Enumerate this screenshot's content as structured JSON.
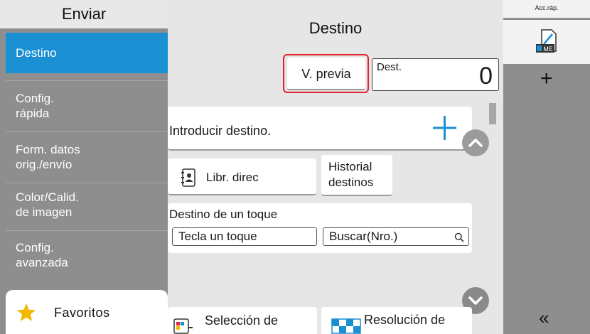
{
  "left": {
    "title": "Enviar",
    "items": [
      {
        "line1": "Destino",
        "line2": ""
      },
      {
        "line1": "Config.",
        "line2": "rápida"
      },
      {
        "line1": "Form. datos",
        "line2": "orig./envío"
      },
      {
        "line1": "Color/Calid.",
        "line2": "de imagen"
      },
      {
        "line1": "Config.",
        "line2": "avanzada"
      }
    ],
    "favorites": "Favoritos"
  },
  "main": {
    "title": "Destino",
    "preview": "V. previa",
    "dest_label": "Dest.",
    "dest_count": "0",
    "enter_destination": "Introducir destino.",
    "address_book": "Libr. direc",
    "history_line1": "Historial",
    "history_line2": "destinos",
    "one_touch_title": "Destino de un toque",
    "one_touch_key": "Tecla un toque",
    "search_number": "Buscar(Nro.)",
    "selection_partial": "Selección de",
    "resolution_partial": "Resolución de"
  },
  "right": {
    "quick_access": "Acc.ráp.",
    "add": "+",
    "collapse": "«"
  },
  "colors": {
    "accent_blue": "#1a8fd4",
    "highlight_red": "#e2232a",
    "panel_gray": "#8e8e8e",
    "favorite_star": "#f5b800"
  }
}
